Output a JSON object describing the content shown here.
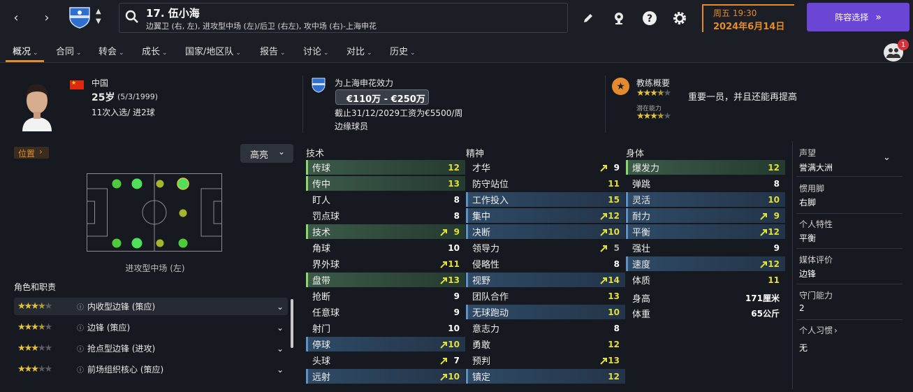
{
  "topbar": {
    "player_name": "17. 伍小海",
    "positions_line": "边翼卫 (右, 左), 进攻型中场 (左)/后卫 (右左), 攻中场 (右)-上海申花",
    "date_day": "周五 19:30",
    "date_full": "2024年6月14日",
    "squad_button": "阵容选择"
  },
  "tabs": [
    "概况",
    "合同",
    "转会",
    "成长",
    "国家/地区队",
    "报告",
    "讨论",
    "对比",
    "历史"
  ],
  "notification_count": "1",
  "profile": {
    "nation": "中国",
    "age": "25岁",
    "dob": "(5/3/1999)",
    "caps": "11次入选/ 进2球"
  },
  "club": {
    "plays_for": "为上海申花效力",
    "value": "€110万 - €250万",
    "contract": "截止31/12/2029工资为€5500/周",
    "status": "边缘球员"
  },
  "coach": {
    "title": "教练概要",
    "comment": "重要一员，并且还能再提高",
    "potential_label": "潜在能力",
    "current_stars": 3.5,
    "potential_stars": 3.5
  },
  "position_panel": {
    "title": "位置",
    "highlight_btn": "高亮",
    "pitch_caption": "进攻型中场 (左)"
  },
  "roles": {
    "title": "角色和职责",
    "items": [
      {
        "name": "内收型边锋 (策应)",
        "stars": 3.5
      },
      {
        "name": "边锋 (策应)",
        "stars": 3.5
      },
      {
        "name": "抢点型边锋 (进攻)",
        "stars": 3
      },
      {
        "name": "前场组织核心 (策应)",
        "stars": 3
      }
    ]
  },
  "attributes": {
    "technical": {
      "title": "技术",
      "rows": [
        {
          "n": "传球",
          "v": "12",
          "hl": "green"
        },
        {
          "n": "传中",
          "v": "13",
          "hl": "green"
        },
        {
          "n": "盯人",
          "v": "8"
        },
        {
          "n": "罚点球",
          "v": "8"
        },
        {
          "n": "技术",
          "v": "9",
          "hl": "green",
          "arrow": "up"
        },
        {
          "n": "角球",
          "v": "10"
        },
        {
          "n": "界外球",
          "v": "11",
          "arrow": "up"
        },
        {
          "n": "盘带",
          "v": "13",
          "hl": "green",
          "arrow": "up"
        },
        {
          "n": "抢断",
          "v": "9"
        },
        {
          "n": "任意球",
          "v": "9"
        },
        {
          "n": "射门",
          "v": "10"
        },
        {
          "n": "停球",
          "v": "10",
          "hl": "blue",
          "arrow": "up"
        },
        {
          "n": "头球",
          "v": "7",
          "arrow": "up"
        },
        {
          "n": "远射",
          "v": "10",
          "hl": "blue",
          "arrow": "up"
        }
      ]
    },
    "mental": {
      "title": "精神",
      "rows": [
        {
          "n": "才华",
          "v": "9",
          "arrow": "up"
        },
        {
          "n": "防守站位",
          "v": "11"
        },
        {
          "n": "工作投入",
          "v": "15",
          "hl": "blue"
        },
        {
          "n": "集中",
          "v": "12",
          "hl": "blue",
          "arrow": "up"
        },
        {
          "n": "决断",
          "v": "10",
          "hl": "blue",
          "arrow": "up"
        },
        {
          "n": "领导力",
          "v": "5",
          "arrow": "up",
          "dim": true
        },
        {
          "n": "侵略性",
          "v": "8"
        },
        {
          "n": "视野",
          "v": "14",
          "hl": "blue",
          "arrow": "up"
        },
        {
          "n": "团队合作",
          "v": "13"
        },
        {
          "n": "无球跑动",
          "v": "10",
          "hl": "blue"
        },
        {
          "n": "意志力",
          "v": "8"
        },
        {
          "n": "勇敢",
          "v": "12"
        },
        {
          "n": "预判",
          "v": "13",
          "arrow": "up"
        },
        {
          "n": "镇定",
          "v": "12",
          "hl": "blue"
        }
      ]
    },
    "physical": {
      "title": "身体",
      "rows": [
        {
          "n": "爆发力",
          "v": "12",
          "hl": "green"
        },
        {
          "n": "弹跳",
          "v": "8"
        },
        {
          "n": "灵活",
          "v": "10",
          "hl": "blue"
        },
        {
          "n": "耐力",
          "v": "9",
          "hl": "blue",
          "arrow": "up"
        },
        {
          "n": "平衡",
          "v": "12",
          "hl": "blue",
          "arrow": "up"
        },
        {
          "n": "强壮",
          "v": "9"
        },
        {
          "n": "速度",
          "v": "12",
          "hl": "blue",
          "arrow": "up"
        },
        {
          "n": "体质",
          "v": "11"
        }
      ]
    },
    "height_label": "身高",
    "height": "171厘米",
    "weight_label": "体重",
    "weight": "65公斤"
  },
  "side": {
    "items": [
      {
        "h": "声望",
        "v": "誉满大洲"
      },
      {
        "h": "惯用脚",
        "v": "右脚"
      },
      {
        "h": "个人特性",
        "v": "平衡"
      },
      {
        "h": "媒体评价",
        "v": "边锋"
      },
      {
        "h": "守门能力",
        "v": "2"
      },
      {
        "h": "个人习惯",
        "v": "无"
      }
    ]
  },
  "colors": {
    "accent": "#e48b2e",
    "primary_button": "#6a45d6",
    "stars": "#e6c23a"
  }
}
